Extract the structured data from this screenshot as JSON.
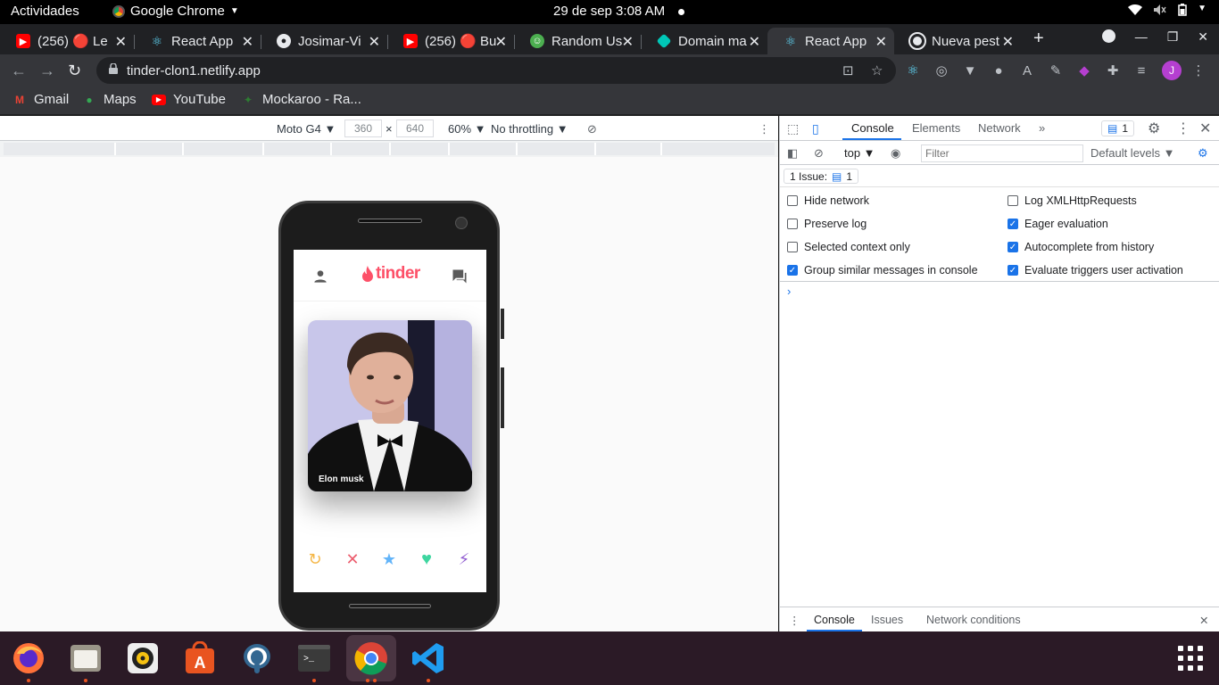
{
  "system": {
    "activities": "Actividades",
    "app_name": "Google Chrome",
    "clock": "29 de sep   3:08 AM"
  },
  "tabs": [
    {
      "title": "(256) 🔴 Le",
      "icon": "youtube-icon"
    },
    {
      "title": "React App",
      "icon": "react-icon"
    },
    {
      "title": "Josimar-Vi",
      "icon": "github-icon"
    },
    {
      "title": "(256) 🔴 Bu",
      "icon": "youtube-icon"
    },
    {
      "title": "Random Us",
      "icon": "random-user-icon"
    },
    {
      "title": "Domain ma",
      "icon": "netlify-icon"
    },
    {
      "title": "React App",
      "icon": "react-icon",
      "active": true
    },
    {
      "title": "Nueva pest",
      "icon": "chrome-icon"
    }
  ],
  "omnibox": {
    "url": "tinder-clon1.netlify.app"
  },
  "bookmarks": [
    {
      "label": "Gmail",
      "icon": "gmail-icon"
    },
    {
      "label": "Maps",
      "icon": "maps-icon"
    },
    {
      "label": "YouTube",
      "icon": "youtube-icon"
    },
    {
      "label": "Mockaroo - Ra...",
      "icon": "mockaroo-icon"
    }
  ],
  "device_toolbar": {
    "device": "Moto G4 ▼",
    "width": "360",
    "height": "640",
    "zoom": "60% ▼",
    "throttling": "No throttling ▼"
  },
  "app": {
    "brand": "tinder",
    "card_name": "Elon musk",
    "brand_color": "#fd5068"
  },
  "devtools": {
    "tabs": [
      "Console",
      "Elements",
      "Network"
    ],
    "issues_count": "1",
    "context": "top ▼",
    "filter_placeholder": "Filter",
    "levels": "Default levels ▼",
    "issue_label": "1 Issue:",
    "settings": [
      {
        "label": "Hide network",
        "checked": false
      },
      {
        "label": "Log XMLHttpRequests",
        "checked": false
      },
      {
        "label": "Preserve log",
        "checked": false
      },
      {
        "label": "Eager evaluation",
        "checked": true
      },
      {
        "label": "Selected context only",
        "checked": false
      },
      {
        "label": "Autocomplete from history",
        "checked": true
      },
      {
        "label": "Group similar messages in console",
        "checked": true
      },
      {
        "label": "Evaluate triggers user activation",
        "checked": true
      }
    ],
    "drawer_tabs": [
      "Console",
      "Issues",
      "Network conditions"
    ]
  },
  "avatar_letter": "J"
}
